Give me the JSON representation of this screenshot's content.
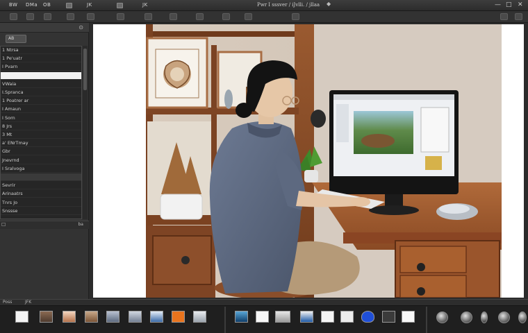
{
  "menubar": {
    "items": [
      "BW",
      "DMa",
      "OB",
      "JK",
      "JK"
    ],
    "title": "Pwr I sssver / iJvlli. / jllaa",
    "window_controls": [
      "—",
      "□",
      "✕"
    ]
  },
  "left_panel": {
    "header": "",
    "chip": "AB",
    "rows": [
      "1 Ntrsa",
      "1 Pe'uatr",
      "I Pvarn",
      "",
      "VWaia",
      "I.Spranca",
      "1 Poatrer ar",
      "I Amaun",
      "I Sorn",
      "8 Jrs",
      "3 Mt",
      "a' ENrTmay",
      "Gbr",
      "Jnevrnd",
      "I Sralvoga",
      "",
      "Sevrir",
      "Arinaatrs",
      "Tnrs Jo",
      "Snssse"
    ],
    "footer_left": "☐",
    "footer_right": "ba"
  },
  "filmstrip": {
    "label_left": "Poss",
    "label_mid": "JFK"
  },
  "colors": {
    "chrome": "#2b2b2b",
    "panel": "#333333",
    "selection": "#f2f2f2"
  }
}
